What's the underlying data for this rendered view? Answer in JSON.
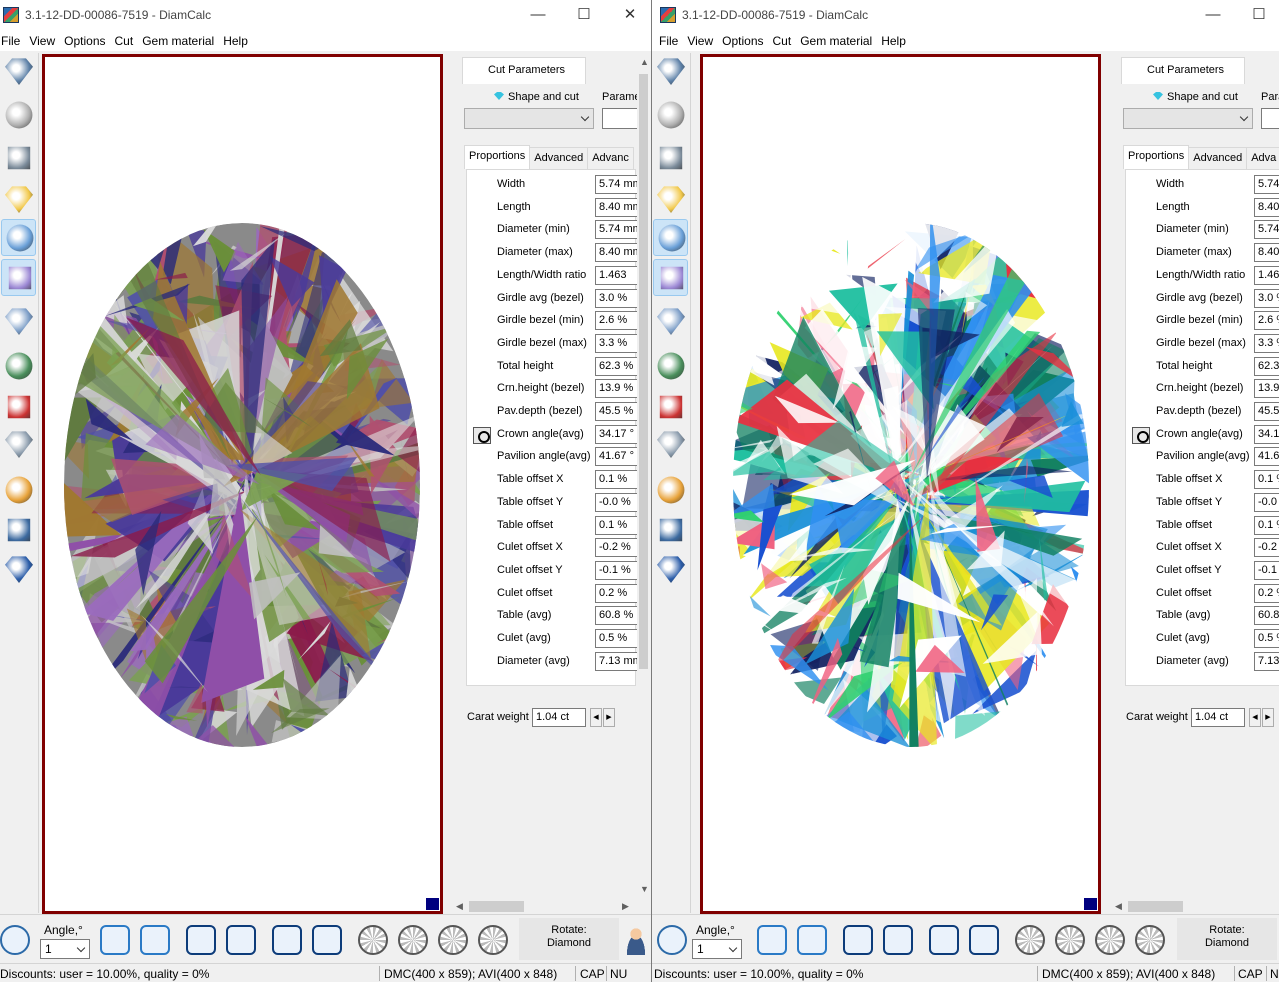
{
  "window": {
    "title": "3.1-12-DD-00086-7519 - DiamCalc",
    "controls": {
      "minimize": "—",
      "maximize": "☐",
      "close": "✕"
    }
  },
  "menu": [
    "File",
    "View",
    "Options",
    "Cut",
    "Gem material",
    "Help"
  ],
  "left_tools": [
    "diamond-top-view-icon",
    "diamond-gray-icon",
    "paint-bucket-icon",
    "light-bulb-icon",
    "diamond-render-icon",
    "rainbow-prism-icon",
    "diamond-image-icon",
    "video-play-icon",
    "video-record-icon",
    "diamond-3d-icon",
    "open-folder-icon",
    "save-disk-icon",
    "word-document-icon"
  ],
  "panel": {
    "tab_cut_parameters": "Cut Parameters",
    "shape_and_cut": "Shape and cut",
    "parameters_short": "Parame",
    "parameters_short_right": "Para",
    "subtabs": [
      "Proportions",
      "Advanced",
      "Advanc"
    ],
    "subtabs_right": [
      "Proportions",
      "Advanced",
      "Adva"
    ],
    "rows": [
      {
        "label": "Width",
        "value": "5.74 mm",
        "value_right": "5.74"
      },
      {
        "label": "Length",
        "value": "8.40 mm",
        "value_right": "8.40"
      },
      {
        "label": "Diameter (min)",
        "value": "5.74 mm",
        "value_right": "5.74"
      },
      {
        "label": "Diameter (max)",
        "value": "8.40 mm",
        "value_right": "8.40"
      },
      {
        "label": "Length/Width ratio",
        "value": "1.463",
        "value_right": "1.463"
      },
      {
        "label": "Girdle avg (bezel)",
        "value": "3.0 %",
        "value_right": "3.0 %"
      },
      {
        "label": "Girdle bezel (min)",
        "value": "2.6 %",
        "value_right": "2.6 %"
      },
      {
        "label": "Girdle bezel (max)",
        "value": "3.3 %",
        "value_right": "3.3 %"
      },
      {
        "label": "Total height",
        "value": "62.3 %",
        "value_right": "62.3"
      },
      {
        "label": "Crn.height (bezel)",
        "value": "13.9 %",
        "value_right": "13.9"
      },
      {
        "label": "Pav.depth (bezel)",
        "value": "45.5 %",
        "value_right": "45.5"
      },
      {
        "label": "Crown angle(avg)",
        "value": "34.17 °",
        "value_right": "34.17"
      },
      {
        "label": "Pavilion angle(avg)",
        "value": "41.67 °",
        "value_right": "41.67"
      },
      {
        "label": "Table offset X",
        "value": "0.1 %",
        "value_right": "0.1 %"
      },
      {
        "label": "Table offset Y",
        "value": "-0.0 %",
        "value_right": "-0.0 %"
      },
      {
        "label": "Table offset",
        "value": "0.1 %",
        "value_right": "0.1 %"
      },
      {
        "label": "Culet offset X",
        "value": "-0.2 %",
        "value_right": "-0.2 %"
      },
      {
        "label": "Culet offset Y",
        "value": "-0.1 %",
        "value_right": "-0.1 %"
      },
      {
        "label": "Culet offset",
        "value": "0.2 %",
        "value_right": "0.2 %"
      },
      {
        "label": "Table (avg)",
        "value": "60.8 %",
        "value_right": "60.8"
      },
      {
        "label": "Culet (avg)",
        "value": "0.5 %",
        "value_right": "0.5 %"
      },
      {
        "label": "Diameter (avg)",
        "value": "7.13 mm",
        "value_right": "7.13"
      }
    ],
    "carat_label": "Carat weight",
    "carat_value": "1.04 ct"
  },
  "bottom": {
    "angle_label": "Angle,°",
    "angle_value": "1",
    "rotate_line1": "Rotate:",
    "rotate_line2": "Diamond"
  },
  "status": {
    "discounts": "Discounts: user = 10.00%, quality = 0%",
    "dmc": "DMC(400 x 859); AVI(400 x 848)",
    "cap": "CAP",
    "num": "NU"
  },
  "colors": {
    "frame": "#800000",
    "accent": "#00007f"
  }
}
